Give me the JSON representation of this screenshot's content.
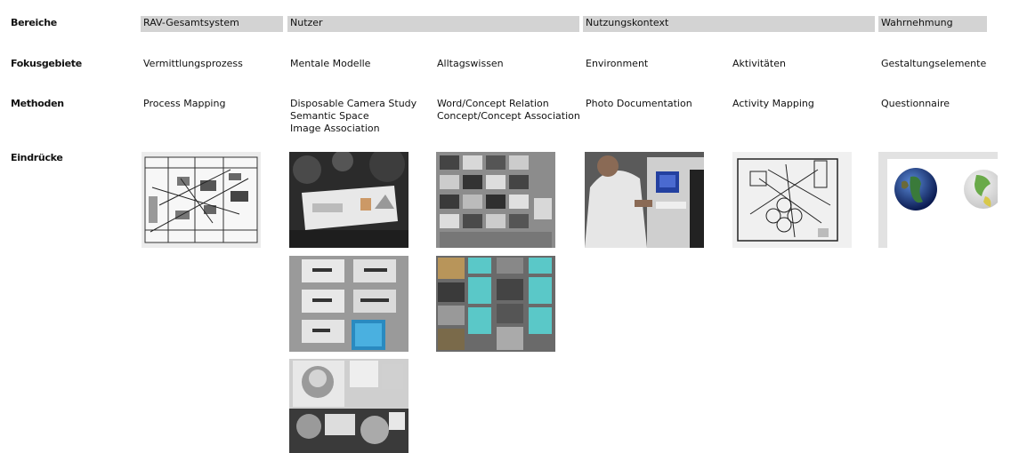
{
  "rows": {
    "bereiche": "Bereiche",
    "fokus": "Fokusgebiete",
    "methoden": "Methoden",
    "eindruecke": "Eindrücke"
  },
  "bereiche": [
    "RAV-Gesamtsystem",
    "Nutzer",
    "Nutzungskontext",
    "Wahrnehmung"
  ],
  "fokusgebiete": [
    "Vermittlungsprozess",
    "Mentale Modelle",
    "Alltagswissen",
    "Environment",
    "Aktivitäten",
    "Gestaltungselemente"
  ],
  "methoden": [
    [
      "Process Mapping"
    ],
    [
      "Disposable Camera Study",
      "Semantic Space",
      "Image Association"
    ],
    [
      "Word/Concept Relation",
      "Concept/Concept Association"
    ],
    [
      "Photo Documentation"
    ],
    [
      "Activity Mapping"
    ],
    [
      "Questionnaire"
    ]
  ]
}
